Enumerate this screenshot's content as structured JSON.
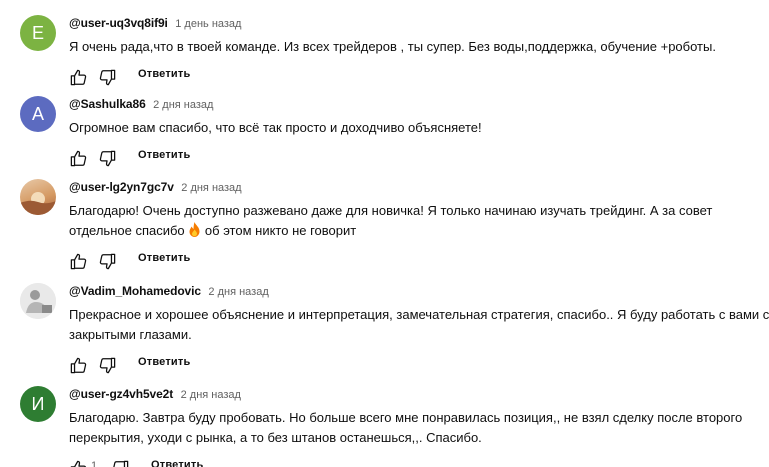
{
  "comments": [
    {
      "author": "@user-uq3vq8if9i",
      "time": "1 день назад",
      "avatar_letter": "E",
      "avatar_color": "#7cb342",
      "lines": [
        "Я очень  рада,что в твоей  команде. Из всех трейдеров , ты супер. Без воды,поддержка, обучение +роботы."
      ],
      "reply_label": "Ответить"
    },
    {
      "author": "@Sashulka86",
      "time": "2 дня назад",
      "avatar_letter": "A",
      "avatar_color": "#5c6bc0",
      "lines": [
        "Огромное вам спасибо, что всё так просто и доходчиво объясняете!"
      ],
      "reply_label": "Ответить"
    },
    {
      "author": "@user-lg2yn7gc7v",
      "time": "2 дня назад",
      "avatar_letter": "",
      "avatar_color": "#c98a55",
      "lines": [
        "Благодарю! Очень доступно разжевано даже для новичка! Я только начинаю изучать трейдинг. А за совет",
        "отдельное спасибо",
        "об этом никто не говорит"
      ],
      "reply_label": "Ответить"
    },
    {
      "author": "@Vadim_Mohamedovic",
      "time": "2 дня назад",
      "avatar_letter": "",
      "avatar_color": "#dcdcdc",
      "lines": [
        "Прекрасное и хорошее объяснение и интерпретация, замечательная стратегия, спасибо.. Я буду работать с вами с",
        "закрытыми глазами."
      ],
      "reply_label": "Ответить"
    },
    {
      "author": "@user-gz4vh5ve2t",
      "time": "2 дня назад",
      "avatar_letter": "И",
      "avatar_color": "#2e7d32",
      "lines": [
        "Благодарю. Завтра буду пробовать. Но больше всего мне понравилась позиция,, не взял сделку после второго",
        "перекрытия, уходи с рынка, а то без штанов останешься,,. Спасибо."
      ],
      "like_count": "1",
      "reply_label": "Ответить"
    }
  ],
  "icons": {
    "like": "thumbs-up-icon",
    "dislike": "thumbs-down-icon",
    "emoji": "fire-emoji"
  }
}
